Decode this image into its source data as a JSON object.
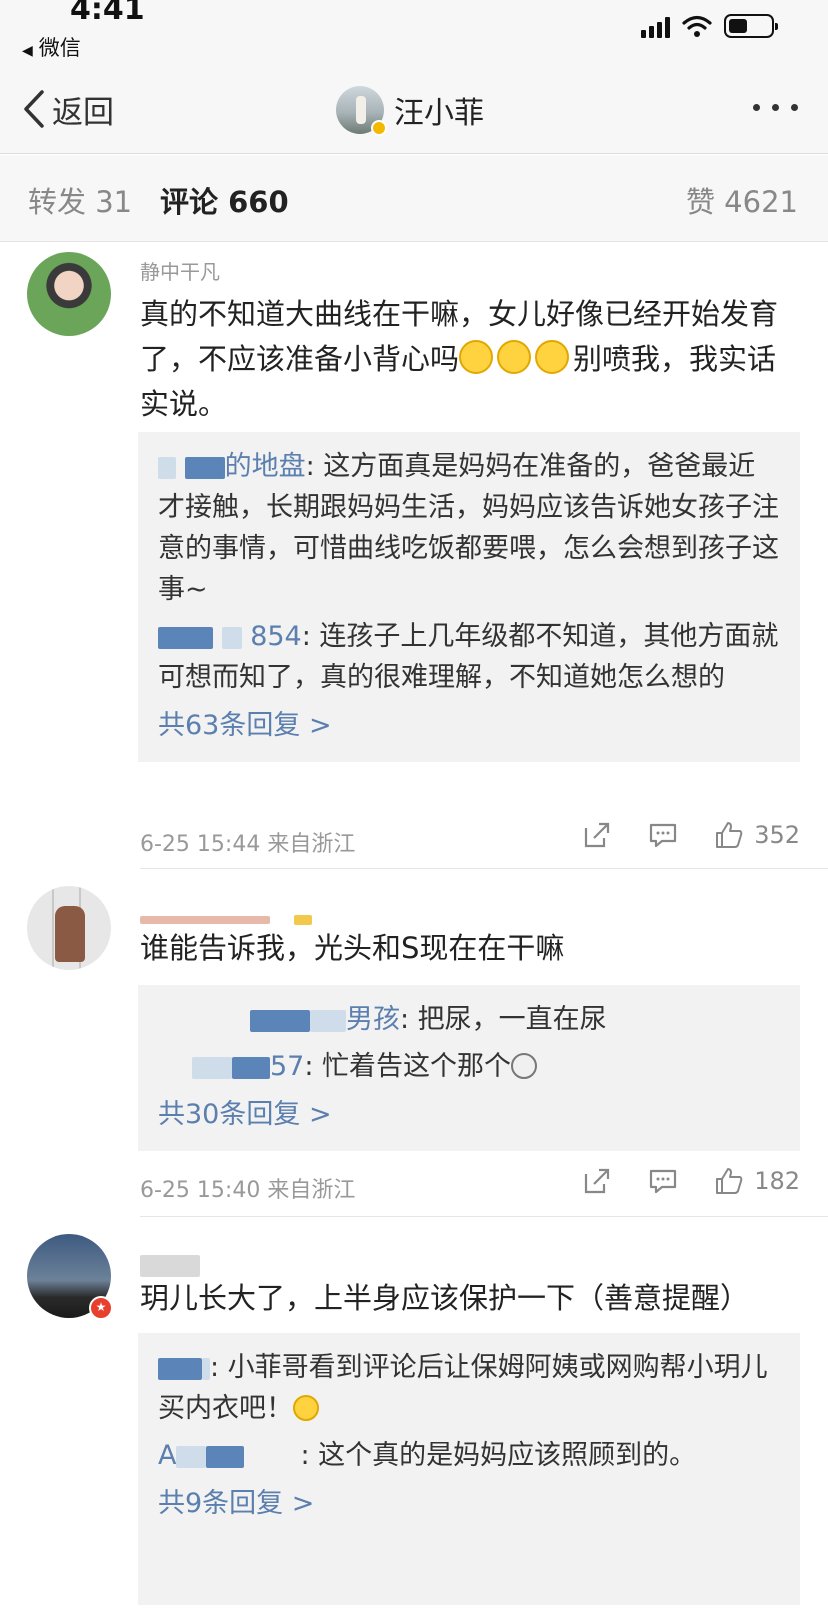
{
  "status_bar": {
    "time": "4:41",
    "back_app": "微信"
  },
  "nav": {
    "back_label": "返回",
    "title": "汪小菲"
  },
  "tabs": {
    "repost": "转发 31",
    "comments": "评论 660",
    "likes": "赞 4621"
  },
  "comments": [
    {
      "username_visible": "静中干凡",
      "text_a": "真的不知道大曲线在干嘛，女儿好像已经开始发育了，不应该准备小背心吗",
      "text_b": "别喷我，我实话实说。",
      "replies": [
        {
          "name": "的地盘",
          "text": ": 这方面真是妈妈在准备的，爸爸最近才接触，长期跟妈妈生活，妈妈应该告诉她女孩子注意的事情，可惜曲线吃饭都要喂，怎么会想到孩子这事~"
        },
        {
          "name": "854",
          "text": ": 连孩子上几年级都不知道，其他方面就可想而知了，真的很难理解，不知道她怎么想的"
        }
      ],
      "reply_total": "共63条回复 >",
      "date": "6-25 15:44",
      "source": "来自浙江",
      "likes": "352"
    },
    {
      "text": "谁能告诉我，光头和S现在在干嘛",
      "replies": [
        {
          "name": "男孩",
          "text": ": 把尿，一直在尿"
        },
        {
          "name": "57",
          "text": ": 忙着告这个那个"
        }
      ],
      "reply_total": "共30条回复 >",
      "date": "6-25 15:40",
      "source": "来自浙江",
      "likes": "182"
    },
    {
      "text": "玥儿长大了，上半身应该保护一下（善意提醒）",
      "replies": [
        {
          "name": "",
          "text": ": 小菲哥看到评论后让保姆阿姨或网购帮小玥儿买内衣吧！"
        },
        {
          "name": "A",
          "text": ": 这个真的是妈妈应该照顾到的。"
        }
      ],
      "reply_total": "共9条回复 >"
    }
  ],
  "icons": {
    "share": "share-icon",
    "comment": "comment-icon",
    "like": "thumbs-up-icon",
    "more": "more-dots-icon",
    "back": "chevron-left-icon"
  },
  "colors": {
    "link_blue": "#5b7fae",
    "reply_bg": "#f2f2f2",
    "meta_gray": "#999999"
  }
}
